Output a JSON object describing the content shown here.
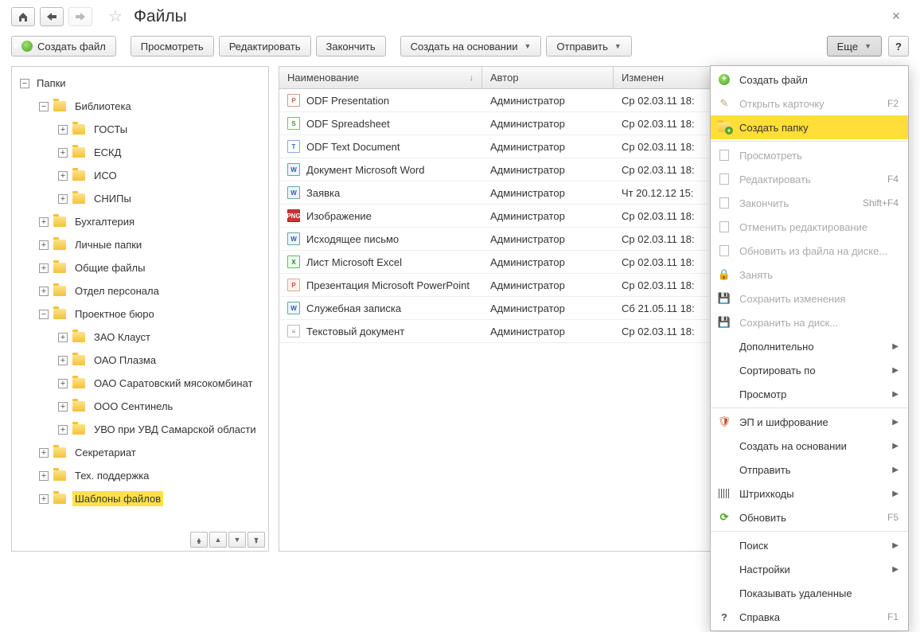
{
  "header": {
    "title": "Файлы"
  },
  "toolbar": {
    "create_file": "Создать файл",
    "view": "Просмотреть",
    "edit": "Редактировать",
    "finish": "Закончить",
    "create_on_basis": "Создать на основании",
    "send": "Отправить",
    "more": "Еще",
    "help": "?"
  },
  "tree": {
    "root": "Папки",
    "items": [
      {
        "label": "Библиотека",
        "depth": 1,
        "exp": "−"
      },
      {
        "label": "ГОСТы",
        "depth": 2,
        "exp": "+"
      },
      {
        "label": "ЕСКД",
        "depth": 2,
        "exp": "+"
      },
      {
        "label": "ИСО",
        "depth": 2,
        "exp": "+"
      },
      {
        "label": "СНИПы",
        "depth": 2,
        "exp": "+"
      },
      {
        "label": "Бухгалтерия",
        "depth": 1,
        "exp": "+"
      },
      {
        "label": "Личные папки",
        "depth": 1,
        "exp": "+"
      },
      {
        "label": "Общие файлы",
        "depth": 1,
        "exp": "+"
      },
      {
        "label": "Отдел персонала",
        "depth": 1,
        "exp": "+"
      },
      {
        "label": "Проектное бюро",
        "depth": 1,
        "exp": "−"
      },
      {
        "label": "ЗАО Клауст",
        "depth": 2,
        "exp": "+"
      },
      {
        "label": "ОАО Плазма",
        "depth": 2,
        "exp": "+"
      },
      {
        "label": "ОАО Саратовский мясокомбинат",
        "depth": 2,
        "exp": "+"
      },
      {
        "label": "ООО Сентинель",
        "depth": 2,
        "exp": "+"
      },
      {
        "label": "УВО при УВД Самарской области",
        "depth": 2,
        "exp": "+"
      },
      {
        "label": "Секретариат",
        "depth": 1,
        "exp": "+"
      },
      {
        "label": "Тех. поддержка",
        "depth": 1,
        "exp": "+"
      },
      {
        "label": "Шаблоны файлов",
        "depth": 1,
        "exp": "+",
        "selected": true
      }
    ]
  },
  "files": {
    "columns": {
      "name": "Наименование",
      "author": "Автор",
      "modified": "Изменен"
    },
    "rows": [
      {
        "ico": "odp",
        "name": "ODF Presentation",
        "author": "Администратор",
        "modified": "Ср 02.03.11 18:"
      },
      {
        "ico": "ods",
        "name": "ODF Spreadsheet",
        "author": "Администратор",
        "modified": "Ср 02.03.11 18:"
      },
      {
        "ico": "odt",
        "name": "ODF Text Document",
        "author": "Администратор",
        "modified": "Ср 02.03.11 18:"
      },
      {
        "ico": "doc",
        "name": "Документ Microsoft Word",
        "author": "Администратор",
        "modified": "Ср 02.03.11 18:"
      },
      {
        "ico": "doc",
        "name": "Заявка",
        "author": "Администратор",
        "modified": "Чт 20.12.12 15:"
      },
      {
        "ico": "png",
        "name": "Изображение",
        "author": "Администратор",
        "modified": "Ср 02.03.11 18:"
      },
      {
        "ico": "doc",
        "name": "Исходящее письмо",
        "author": "Администратор",
        "modified": "Ср 02.03.11 18:"
      },
      {
        "ico": "xls",
        "name": "Лист Microsoft Excel",
        "author": "Администратор",
        "modified": "Ср 02.03.11 18:"
      },
      {
        "ico": "ppt",
        "name": "Презентация Microsoft PowerPoint",
        "author": "Администратор",
        "modified": "Ср 02.03.11 18:"
      },
      {
        "ico": "doc",
        "name": "Служебная записка",
        "author": "Администратор",
        "modified": "Сб 21.05.11 18:"
      },
      {
        "ico": "txt",
        "name": "Текстовый документ",
        "author": "Администратор",
        "modified": "Ср 02.03.11 18:"
      }
    ]
  },
  "menu": [
    {
      "kind": "item",
      "icon": "plus",
      "label": "Создать файл"
    },
    {
      "kind": "item",
      "icon": "pencil",
      "label": "Открыть карточку",
      "short": "F2",
      "disabled": true
    },
    {
      "kind": "item",
      "icon": "folderplus",
      "label": "Создать папку",
      "selected": true
    },
    {
      "kind": "sep"
    },
    {
      "kind": "item",
      "icon": "doc",
      "label": "Просмотреть",
      "disabled": true
    },
    {
      "kind": "item",
      "icon": "doc",
      "label": "Редактировать",
      "short": "F4",
      "disabled": true
    },
    {
      "kind": "item",
      "icon": "doc",
      "label": "Закончить",
      "short": "Shift+F4",
      "disabled": true
    },
    {
      "kind": "item",
      "icon": "doc",
      "label": "Отменить редактирование",
      "disabled": true
    },
    {
      "kind": "item",
      "icon": "doc",
      "label": "Обновить из файла на диске...",
      "disabled": true
    },
    {
      "kind": "item",
      "icon": "lock",
      "label": "Занять",
      "disabled": true
    },
    {
      "kind": "item",
      "icon": "save",
      "label": "Сохранить изменения",
      "disabled": true
    },
    {
      "kind": "item",
      "icon": "save",
      "label": "Сохранить на диск...",
      "disabled": true
    },
    {
      "kind": "item",
      "icon": "",
      "label": "Дополнительно",
      "submenu": true
    },
    {
      "kind": "item",
      "icon": "",
      "label": "Сортировать по",
      "submenu": true
    },
    {
      "kind": "item",
      "icon": "",
      "label": "Просмотр",
      "submenu": true
    },
    {
      "kind": "sep"
    },
    {
      "kind": "item",
      "icon": "shield",
      "label": "ЭП и шифрование",
      "submenu": true
    },
    {
      "kind": "item",
      "icon": "",
      "label": "Создать на основании",
      "submenu": true
    },
    {
      "kind": "item",
      "icon": "",
      "label": "Отправить",
      "submenu": true
    },
    {
      "kind": "item",
      "icon": "barcode",
      "label": "Штрихкоды",
      "submenu": true
    },
    {
      "kind": "item",
      "icon": "refresh",
      "label": "Обновить",
      "short": "F5"
    },
    {
      "kind": "sep"
    },
    {
      "kind": "item",
      "icon": "",
      "label": "Поиск",
      "submenu": true
    },
    {
      "kind": "item",
      "icon": "",
      "label": "Настройки",
      "submenu": true
    },
    {
      "kind": "item",
      "icon": "",
      "label": "Показывать удаленные"
    },
    {
      "kind": "item",
      "icon": "q",
      "label": "Справка",
      "short": "F1"
    }
  ]
}
